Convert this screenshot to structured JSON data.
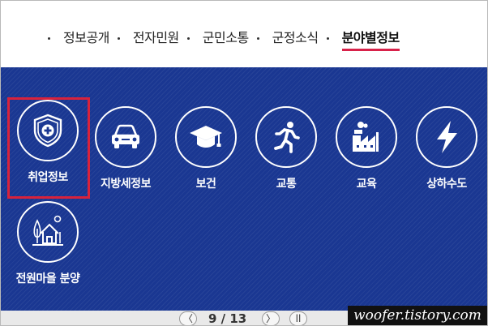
{
  "nav": {
    "items": [
      {
        "label": "정보공개"
      },
      {
        "label": "전자민원"
      },
      {
        "label": "군민소통"
      },
      {
        "label": "군정소식"
      },
      {
        "label": "분야별정보",
        "active": true
      }
    ]
  },
  "tiles": [
    {
      "label": "취업정보",
      "icon": "shield-plus-icon",
      "selected": true
    },
    {
      "label": "지방세정보",
      "icon": "car-icon"
    },
    {
      "label": "보건",
      "icon": "graduation-cap-icon"
    },
    {
      "label": "교통",
      "icon": "running-person-icon"
    },
    {
      "label": "교육",
      "icon": "factory-icon"
    },
    {
      "label": "상하수도",
      "icon": "lightning-icon"
    },
    {
      "label": "전원마을 분양",
      "icon": "village-house-icon"
    }
  ],
  "pager": {
    "prev": "〈",
    "count": "9 / 13",
    "next": "〉",
    "pause": "ll"
  },
  "watermark": "woofer.tistory.com",
  "colors": {
    "panel_blue": "#1a3792",
    "accent_red": "#d8223c"
  }
}
